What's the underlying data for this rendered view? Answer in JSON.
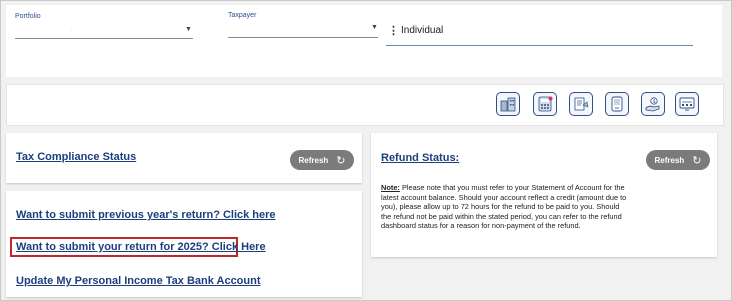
{
  "topbar": {
    "portfolio_label": "Portfolio",
    "portfolio_value": "",
    "taxpayer_label": "Taxpayer",
    "taxpayer_value": "",
    "taxpayer_type": "Individual"
  },
  "toolbar": {
    "icons": [
      "buildings-icon",
      "calculator-icon",
      "document-scan-icon",
      "handheld-device-icon",
      "hand-money-icon",
      "report-screen-icon"
    ]
  },
  "compliance": {
    "title": "Tax Compliance Status",
    "refresh_label": "Refresh"
  },
  "links": {
    "previous_return": "Want to submit previous year's return? Click here",
    "current_return": "Want to submit your return for 2025? Click Here",
    "bank_account": "Update My Personal Income Tax Bank Account"
  },
  "refund": {
    "title": "Refund Status:",
    "refresh_label": "Refresh",
    "note_label": "Note:",
    "note_text": " Please note that you must refer to your Statement of Account for the latest account balance. Should your account reflect a credit (amount due to you), please allow up to 72 hours for the refund to be paid to you. Should the refund not be paid within the stated period, you can refer to the refund dashboard status for a reason for non-payment of the refund."
  },
  "colors": {
    "link": "#1b3f7d",
    "pill": "#7b7b7b",
    "highlight": "#c0272d",
    "icon_border": "#2f4e86"
  }
}
